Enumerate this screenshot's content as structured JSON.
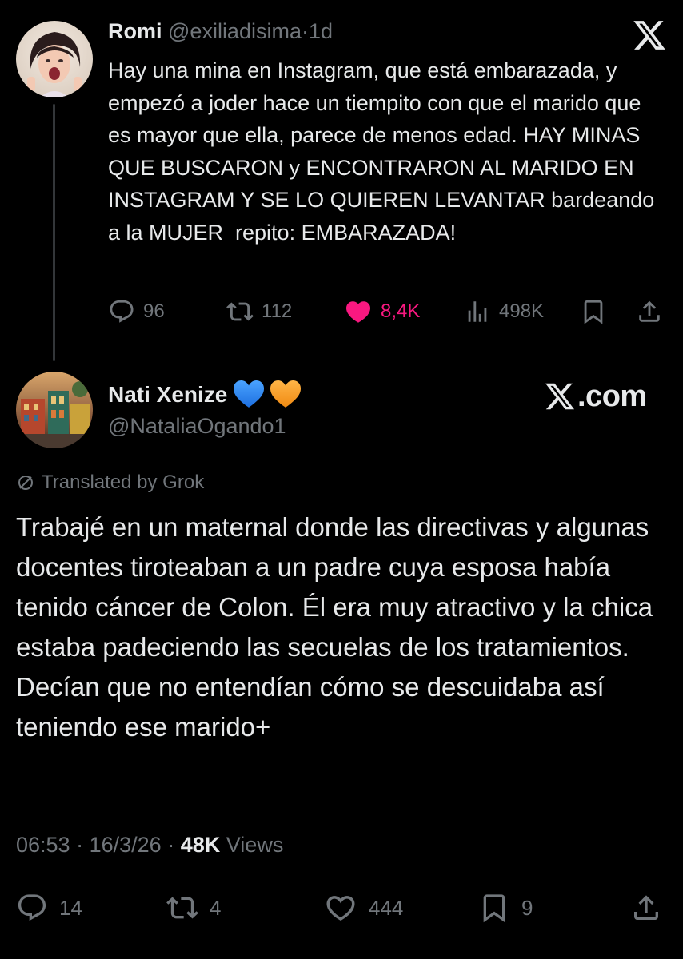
{
  "colors": {
    "background": "#000000",
    "text_primary": "#e7e9ea",
    "text_secondary": "#71767b",
    "like_active": "#f91880",
    "heart_blue": "#1d9bf0",
    "heart_orange": "#f7931e"
  },
  "tweet1": {
    "author_name": "Romi",
    "author_handle": "@exiliadisima",
    "time_separator": "·",
    "time_ago": "1d",
    "body": "Hay una mina en Instagram, que está embarazada, y empezó a joder hace un tiempito con que el marido que es mayor que ella, parece de menos edad. HAY MINAS QUE BUSCARON y ENCONTRARON AL MARIDO EN INSTAGRAM Y SE LO QUIEREN LEVANTAR bardeando a la MUJER  repito: EMBARAZADA!",
    "actions": {
      "replies": "96",
      "reposts": "112",
      "likes": "8,4K",
      "views": "498K"
    },
    "icons": [
      "reply-icon",
      "repost-icon",
      "like-icon-filled",
      "analytics-icon",
      "bookmark-icon",
      "share-icon",
      "x-logo-icon"
    ]
  },
  "tweet2": {
    "author_name": "Nati Xenize",
    "author_handle": "@NataliaOgando1",
    "emojis": [
      "blue-heart-emoji",
      "orange-heart-emoji"
    ],
    "watermark": ".com",
    "translated_label": "Translated by Grok",
    "body": "Trabajé en un maternal donde las directivas y algunas docentes tiroteaban a un padre cuya esposa había tenido cáncer de Colon. Él era muy atractivo y la chica estaba padeciendo las secuelas de los tratamientos. Decían que no entendían cómo se descuidaba así teniendo ese marido+",
    "time": "06:53",
    "date": "16/3/26",
    "separator": "·",
    "views_count": "48K",
    "views_label": "Views",
    "actions": {
      "replies": "14",
      "reposts": "4",
      "likes": "444",
      "bookmarks": "9"
    }
  }
}
